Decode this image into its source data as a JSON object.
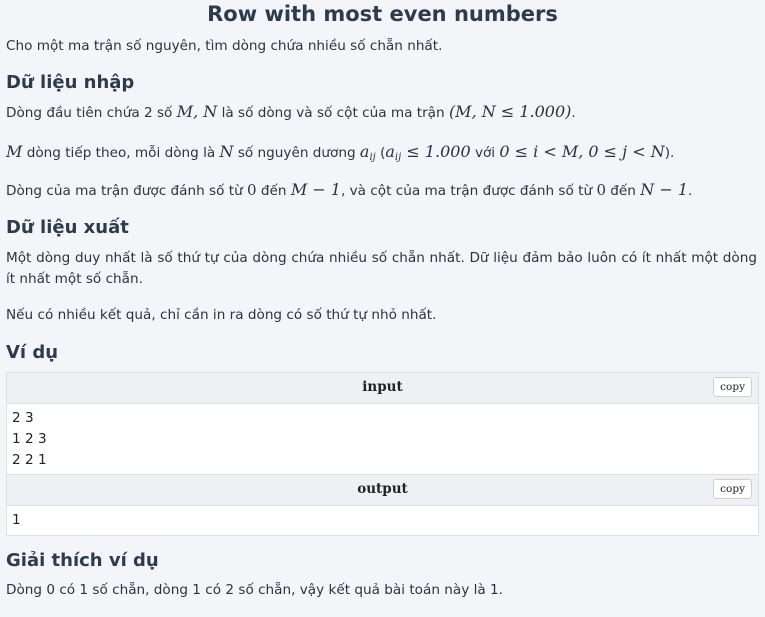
{
  "title": "Row with most even numbers",
  "intro": "Cho một ma trận số nguyên, tìm dòng chứa nhiều số chẵn nhất.",
  "input_section": {
    "heading": "Dữ liệu nhập",
    "line1_prefix": "Dòng đầu tiên chứa 2 số ",
    "line1_math1": "M, N",
    "line1_mid": " là số dòng và số cột của ma trận ",
    "line1_math2": "(M, N ≤ 1.000)",
    "line1_suffix": ".",
    "line2_math1": "M",
    "line2_mid1": " dòng tiếp theo, mỗi dòng là ",
    "line2_math2": "N",
    "line2_mid2": " số nguyên dương ",
    "line2_aij": "a",
    "line2_aij_sub": "ij",
    "line2_paren": " (",
    "line2_cond": "≤ 1.000",
    "line2_with": " với ",
    "line2_cond2": "0 ≤ i < M, 0 ≤ j < N",
    "line2_suffix": ").",
    "line3_prefix": "Dòng của ma trận được đánh số từ ",
    "line3_m1": "0",
    "line3_mid1": " đến ",
    "line3_m2": "M − 1",
    "line3_mid2": ", và cột của ma trận được đánh số từ ",
    "line3_m3": "0",
    "line3_mid3": " đến ",
    "line3_m4": "N − 1",
    "line3_suffix": "."
  },
  "output_section": {
    "heading": "Dữ liệu xuất",
    "para1": "Một dòng duy nhất là số thứ tự của dòng chứa nhiều số chẵn nhất. Dữ liệu đảm bảo luôn có ít nhất một dòng ít nhất một số chẵn.",
    "para2": "Nếu có nhiều kết quả, chỉ cần in ra dòng có số thứ tự nhỏ nhất."
  },
  "example": {
    "heading": "Ví dụ",
    "input_label": "input",
    "input_content": "2 3\n1 2 3\n2 2 1",
    "output_label": "output",
    "output_content": "1",
    "copy_label": "copy"
  },
  "explanation": {
    "heading": "Giải thích ví dụ",
    "text": "Dòng 0 có 1 số chẵn, dòng 1 có 2 số chẵn, vậy kết quả bài toán này là 1."
  }
}
